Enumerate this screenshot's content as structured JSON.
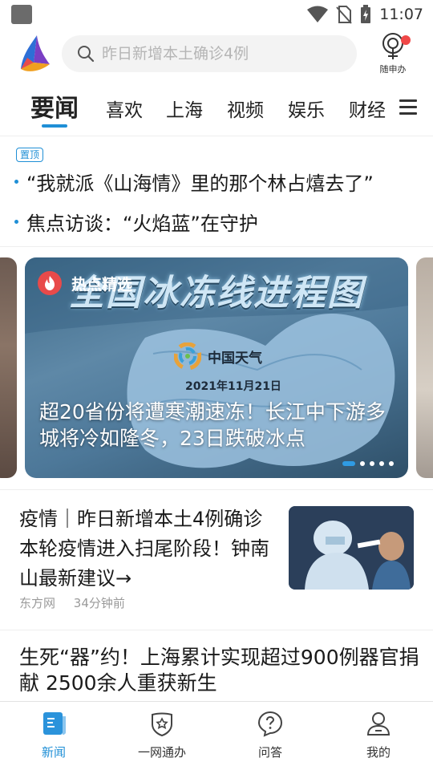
{
  "status_bar": {
    "time": "11:07",
    "icons": [
      "notification-square-icon",
      "wifi-icon",
      "no-sim-icon",
      "battery-charging-icon"
    ]
  },
  "header": {
    "search_placeholder": "昨日新增本土确诊4例",
    "service_label": "随申办"
  },
  "tabs": [
    "要闻",
    "喜欢",
    "上海",
    "视频",
    "娱乐",
    "财经"
  ],
  "active_tab": "要闻",
  "pinned": {
    "badge": "置顶",
    "items": [
      "“我就派《山海情》里的那个林占熺去了”",
      "焦点访谈：“火焰蓝”在守护"
    ]
  },
  "carousel": {
    "tag": "热点精选",
    "image_headline": "全国冰冻线进程图",
    "image_brand": "中国天气",
    "image_date": "2021年11月21日",
    "caption": "超20省份将遭寒潮速冻！长江中下游多城将冷如隆冬，23日跌破冰点",
    "slide_count": 5,
    "active_slide": 1
  },
  "feed": [
    {
      "title": "疫情｜昨日新增本土4例确诊 本轮疫情进入扫尾阶段！钟南山最新建议→",
      "source": "东方网",
      "time": "34分钟前"
    },
    {
      "title": "生死“器”约！上海累计实现超过900例器官捐献 2500余人重获新生"
    }
  ],
  "bottom_nav": {
    "items": [
      {
        "label": "新闻",
        "icon": "news-icon"
      },
      {
        "label": "一网通办",
        "icon": "service-shield-icon"
      },
      {
        "label": "问答",
        "icon": "question-bubble-icon"
      },
      {
        "label": "我的",
        "icon": "profile-icon"
      }
    ],
    "active": "新闻"
  },
  "colors": {
    "accent": "#1f8fd6",
    "notification_dot": "#f04848",
    "text": "#1a1a1a",
    "meta_text": "#9a9a9a"
  }
}
